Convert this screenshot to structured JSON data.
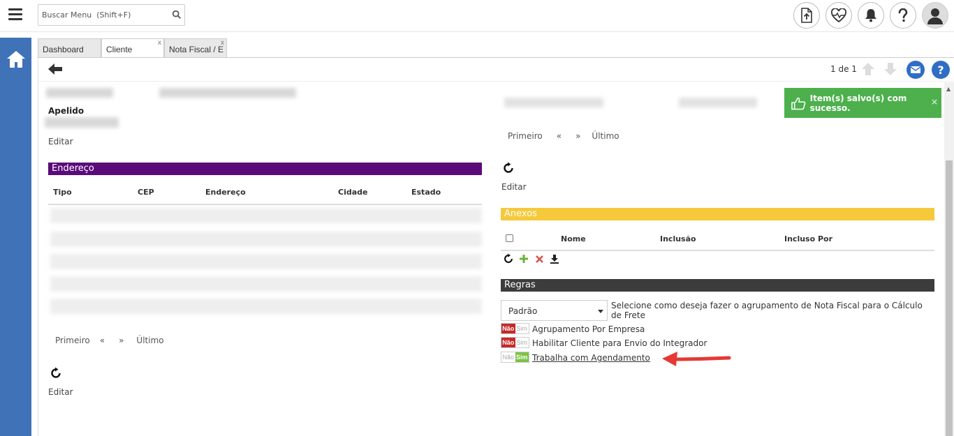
{
  "search": {
    "placeholder": "Buscar Menu  (Shift+F)"
  },
  "tabs": [
    {
      "label": "Dashboard"
    },
    {
      "label": "Cliente",
      "close": "x"
    },
    {
      "label": "Nota Fiscal / E",
      "close": "x"
    }
  ],
  "toolbar": {
    "pager": "1 de 1"
  },
  "left": {
    "apelido_label": "Apelido",
    "editar_1": "Editar",
    "endereco_title": "Endereço",
    "endereco_columns": [
      "Tipo",
      "CEP",
      "Endereço",
      "Cidade",
      "Estado"
    ],
    "pagination": {
      "first": "Primeiro",
      "prev": "«",
      "next": "»",
      "last": "Último"
    },
    "editar_2": "Editar"
  },
  "right": {
    "pagination": {
      "first": "Primeiro",
      "prev": "«",
      "next": "»",
      "last": "Último"
    },
    "editar": "Editar",
    "anexos_title": "Anexos",
    "anexos_columns": [
      "Nome",
      "Inclusão",
      "Incluso Por"
    ],
    "regras_title": "Regras",
    "select_value": "Padrão",
    "select_desc": "Selecione como deseja fazer o agrupamento de Nota Fiscal para o Cálculo de Frete",
    "toggle_no": "Não",
    "toggle_yes": "Sim",
    "rules": [
      {
        "label": "Agrupamento Por Empresa",
        "value": "Não"
      },
      {
        "label": "Habilitar Cliente para Envio do Integrador",
        "value": "Não"
      },
      {
        "label": "Trabalha com Agendamento",
        "value": "Sim"
      }
    ]
  },
  "toast": {
    "text": "Item(s) salvo(s) com sucesso.",
    "close": "×"
  },
  "colors": {
    "rail": "#3f72b6",
    "endereco_header": "#5b0a7a",
    "anexos_header": "#f6c93b",
    "regras_header": "#3c3c3c",
    "toast": "#4db04d",
    "toggle_no": "#c62828",
    "toggle_yes": "#7cc242",
    "arrow": "#e53935"
  }
}
